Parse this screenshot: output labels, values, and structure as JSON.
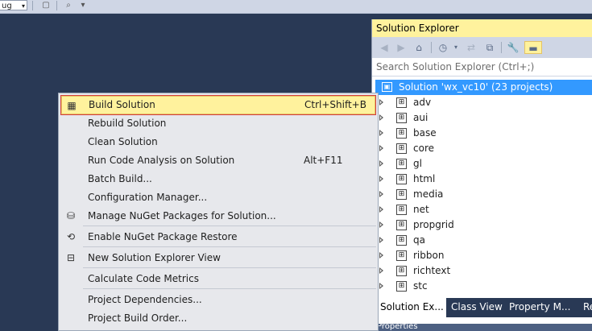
{
  "toolbar": {
    "config_value": "ug"
  },
  "solution_explorer": {
    "title": "Solution Explorer",
    "search_placeholder": "Search Solution Explorer (Ctrl+;)",
    "root_label": "Solution 'wx_vc10' (23 projects)",
    "projects": [
      "adv",
      "aui",
      "base",
      "core",
      "gl",
      "html",
      "media",
      "net",
      "propgrid",
      "qa",
      "ribbon",
      "richtext",
      "stc"
    ],
    "tabs": [
      "Solution Ex...",
      "Class View",
      "Property M...",
      "Re"
    ],
    "bottom_label": "Properties"
  },
  "context_menu": {
    "items": [
      {
        "label": "Build Solution",
        "shortcut": "Ctrl+Shift+B",
        "icon": "build-icon"
      },
      {
        "label": "Rebuild Solution",
        "shortcut": ""
      },
      {
        "label": "Clean Solution",
        "shortcut": ""
      },
      {
        "label": "Run Code Analysis on Solution",
        "shortcut": "Alt+F11"
      },
      {
        "label": "Batch Build...",
        "shortcut": ""
      },
      {
        "label": "Configuration Manager...",
        "shortcut": ""
      },
      {
        "label": "Manage NuGet Packages for Solution...",
        "shortcut": "",
        "icon": "nuget-icon"
      },
      {
        "label": "Enable NuGet Package Restore",
        "shortcut": "",
        "icon": "restore-icon"
      },
      {
        "label": "New Solution Explorer View",
        "shortcut": "",
        "icon": "new-view-icon"
      },
      {
        "label": "Calculate Code Metrics",
        "shortcut": ""
      },
      {
        "label": "Project Dependencies...",
        "shortcut": ""
      },
      {
        "label": "Project Build Order...",
        "shortcut": ""
      }
    ]
  },
  "colors": {
    "ide_background": "#293955",
    "highlight": "#fff29d",
    "selection": "#3399ff",
    "outline_red": "#d53f3f"
  }
}
